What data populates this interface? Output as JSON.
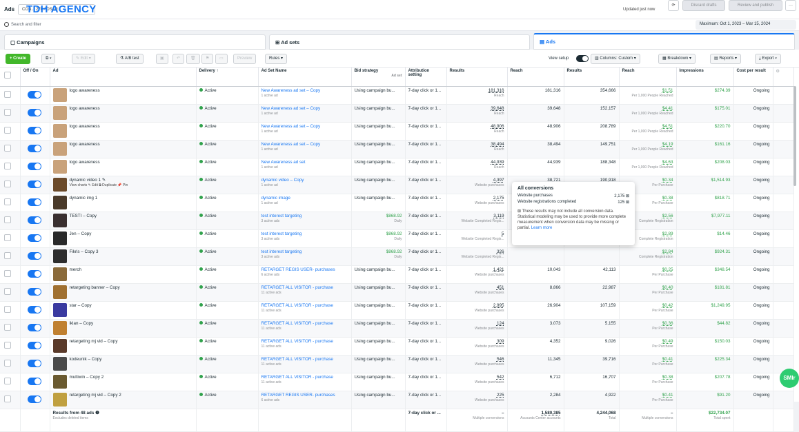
{
  "topbar": {
    "section": "Ads",
    "account": "CON... 270 ADSAP...",
    "watermark": "TDH AGENCY",
    "updated": "Updated just now",
    "discard": "Discard drafts",
    "review": "Review and publish",
    "more": "···"
  },
  "search": {
    "placeholder": "Search and filter",
    "date_range": "Maximum: Oct 1, 2023 – Mar 15, 2024"
  },
  "tabs": {
    "campaigns": "Campaigns",
    "adsets": "Ad sets",
    "ads": "Ads"
  },
  "toolbar": {
    "create": "+ Create",
    "edit": "Edit",
    "ab_test": "A/B test",
    "preview": "Preview",
    "rules": "Rules",
    "view_setup": "View setup",
    "columns": "Columns: Custom",
    "breakdown": "Breakdown",
    "reports": "Reports",
    "export": "Export"
  },
  "columns": [
    "Off / On",
    "Ad",
    "Delivery ↑",
    "Ad Set Name",
    "Bid strategy",
    "Attribution setting",
    "Results",
    "Reach",
    "Results",
    "Reach",
    "Impressions",
    "Cost per result"
  ],
  "bid_sub": "Ad set",
  "rows": [
    {
      "ad": "logo awareness",
      "delivery": "Active",
      "adset": "New Awareness ad set – Copy",
      "adset_sub": "1 active ad",
      "bid": "Using campaign bu...",
      "bid_sub": "",
      "attr": "7-day click or 1...",
      "results": "181,316",
      "results_sub": "Reach",
      "reach": "181,316",
      "impr": "354,666",
      "cpr": "$1.51",
      "cpr_sub": "Per 1,000 People Reached",
      "spent": "$274.39",
      "ending": "Ongoing"
    },
    {
      "ad": "logo awareness",
      "delivery": "Active",
      "adset": "New Awareness ad set – Copy",
      "adset_sub": "1 active ad",
      "bid": "Using campaign bu...",
      "bid_sub": "",
      "attr": "7-day click or 1...",
      "results": "39,648",
      "results_sub": "Reach",
      "reach": "39,648",
      "impr": "152,157",
      "cpr": "$4.41",
      "cpr_sub": "Per 1,000 People Reached",
      "spent": "$175.01",
      "ending": "Ongoing"
    },
    {
      "ad": "logo awareness",
      "delivery": "Active",
      "adset": "New Awareness ad set – Copy",
      "adset_sub": "1 active ad",
      "bid": "Using campaign bu...",
      "bid_sub": "",
      "attr": "7-day click or 1...",
      "results": "48,906",
      "results_sub": "Reach",
      "reach": "48,906",
      "impr": "208,789",
      "cpr": "$4.51",
      "cpr_sub": "Per 1,000 People Reached",
      "spent": "$220.70",
      "ending": "Ongoing"
    },
    {
      "ad": "logo awareness",
      "delivery": "Active",
      "adset": "New Awareness ad set – Copy",
      "adset_sub": "1 active ad",
      "bid": "Using campaign bu...",
      "bid_sub": "",
      "attr": "7-day click or 1...",
      "results": "38,494",
      "results_sub": "Reach",
      "reach": "38,494",
      "impr": "149,751",
      "cpr": "$4.19",
      "cpr_sub": "Per 1,000 People Reached",
      "spent": "$161.16",
      "ending": "Ongoing"
    },
    {
      "ad": "logo awareness",
      "delivery": "Active",
      "adset": "New Awareness ad set",
      "adset_sub": "1 active ad",
      "bid": "Using campaign bu...",
      "bid_sub": "",
      "attr": "7-day click or 1...",
      "results": "44,939",
      "results_sub": "Reach",
      "reach": "44,939",
      "impr": "188,348",
      "cpr": "$4.63",
      "cpr_sub": "Per 1,000 People Reached",
      "spent": "$208.03",
      "ending": "Ongoing"
    },
    {
      "ad": "dynamic video 1 ✎",
      "ad_actions": "View charts  ✎ Edit  ⧉ Duplicate  📌 Pin",
      "delivery": "Active",
      "adset": "dynamic video – Copy",
      "adset_sub": "1 active ad",
      "bid": "Using campaign bu...",
      "bid_sub": "",
      "attr": "7-day click or 1...",
      "results": "4,397",
      "results_sub": "Website purchases",
      "reach": "38,721",
      "impr": "190,918",
      "cpr": "$0.34",
      "cpr_sub": "Per Purchase",
      "spent": "$1,514.93",
      "ending": "Ongoing"
    },
    {
      "ad": "dynamic img 1",
      "delivery": "Active",
      "adset": "dynamic image",
      "adset_sub": "1 active ad",
      "bid": "Using campaign bu...",
      "bid_sub": "",
      "attr": "7-day click or 1...",
      "results": "2,175",
      "results_sub": "Website purchases",
      "reach": "",
      "impr": "",
      "cpr": "$0.38",
      "cpr_sub": "Per Purchase",
      "spent": "$818.71",
      "ending": "Ongoing"
    },
    {
      "ad": "TESTI – Copy",
      "delivery": "Active",
      "adset": "test interest targeting",
      "adset_sub": "3 active ads",
      "bid": "$868.92",
      "bid_sub": "Daily",
      "attr": "7-day click or 1...",
      "results": "3,119",
      "results_sub": "Website Completed Regis...",
      "reach": "",
      "impr": "",
      "cpr": "$2.56",
      "cpr_sub": "Complete Registration",
      "spent": "$7,977.11",
      "ending": "Ongoing"
    },
    {
      "ad": "Jen – Copy",
      "delivery": "Active",
      "adset": "test interest targeting",
      "adset_sub": "3 active ads",
      "bid": "$868.92",
      "bid_sub": "Daily",
      "attr": "7-day click or 1...",
      "results": "5",
      "results_sub": "Website Completed Regis...",
      "reach": "",
      "impr": "",
      "cpr": "$2.89",
      "cpr_sub": "Complete Registration",
      "spent": "$14.46",
      "ending": "Ongoing"
    },
    {
      "ad": "Fikris – Copy 3",
      "delivery": "Active",
      "adset": "test interest targeting",
      "adset_sub": "3 active ads",
      "bid": "$868.92",
      "bid_sub": "Daily",
      "attr": "7-day click or 1...",
      "results": "326",
      "results_sub": "Website Completed Regis...",
      "reach": "",
      "impr": "",
      "cpr": "$2.84",
      "cpr_sub": "Complete Registration",
      "spent": "$924.31",
      "ending": "Ongoing"
    },
    {
      "ad": "merch",
      "delivery": "Active",
      "adset": "RETARGET REGIS USER- purchases",
      "adset_sub": "6 active ads",
      "bid": "Using campaign bu...",
      "bid_sub": "",
      "attr": "7-day click or 1...",
      "results": "1,421",
      "results_sub": "Website purchases",
      "reach": "10,043",
      "impr": "42,113",
      "cpr": "$0.25",
      "cpr_sub": "Per Purchase",
      "spent": "$348.54",
      "ending": "Ongoing"
    },
    {
      "ad": "retargeting banner – Copy",
      "delivery": "Active",
      "adset": "RETARGET ALL VISITOR - purchase",
      "adset_sub": "11 active ads",
      "bid": "Using campaign bu...",
      "bid_sub": "",
      "attr": "7-day click or 1...",
      "results": "451",
      "results_sub": "Website purchases",
      "reach": "8,866",
      "impr": "22,987",
      "cpr": "$0.40",
      "cpr_sub": "Per Purchase",
      "spent": "$181.81",
      "ending": "Ongoing"
    },
    {
      "ad": "star – Copy",
      "delivery": "Active",
      "adset": "RETARGET ALL VISITOR - purchase",
      "adset_sub": "11 active ads",
      "bid": "Using campaign bu...",
      "bid_sub": "",
      "attr": "7-day click or 1...",
      "results": "2,995",
      "results_sub": "Website purchases",
      "reach": "26,904",
      "impr": "107,159",
      "cpr": "$0.42",
      "cpr_sub": "Per Purchase",
      "spent": "$1,249.95",
      "ending": "Ongoing"
    },
    {
      "ad": "iklan – Copy",
      "delivery": "Active",
      "adset": "RETARGET ALL VISITOR - purchase",
      "adset_sub": "11 active ads",
      "bid": "Using campaign bu...",
      "bid_sub": "",
      "attr": "7-day click or 1...",
      "results": "124",
      "results_sub": "Website purchases",
      "reach": "3,073",
      "impr": "5,155",
      "cpr": "$0.36",
      "cpr_sub": "Per Purchase",
      "spent": "$44.82",
      "ending": "Ongoing"
    },
    {
      "ad": "retargeting mj vid – Copy",
      "delivery": "Active",
      "adset": "RETARGET ALL VISITOR - purchase",
      "adset_sub": "11 active ads",
      "bid": "Using campaign bu...",
      "bid_sub": "",
      "attr": "7-day click or 1...",
      "results": "309",
      "results_sub": "Website purchases",
      "reach": "4,352",
      "impr": "9,026",
      "cpr": "$0.49",
      "cpr_sub": "Per Purchase",
      "spent": "$150.03",
      "ending": "Ongoing"
    },
    {
      "ad": "kodeunik – Copy",
      "delivery": "Active",
      "adset": "RETARGET ALL VISITOR - purchase",
      "adset_sub": "11 active ads",
      "bid": "Using campaign bu...",
      "bid_sub": "",
      "attr": "7-day click or 1...",
      "results": "546",
      "results_sub": "Website purchases",
      "reach": "11,345",
      "impr": "39,716",
      "cpr": "$0.41",
      "cpr_sub": "Per Purchase",
      "spent": "$225.34",
      "ending": "Ongoing"
    },
    {
      "ad": "multiwin – Copy 2",
      "delivery": "Active",
      "adset": "RETARGET ALL VISITOR - purchase",
      "adset_sub": "11 active ads",
      "bid": "Using campaign bu...",
      "bid_sub": "",
      "attr": "7-day click or 1...",
      "results": "542",
      "results_sub": "Website purchases",
      "reach": "6,712",
      "impr": "16,707",
      "cpr": "$0.38",
      "cpr_sub": "Per Purchase",
      "spent": "$207.78",
      "ending": "Ongoing"
    },
    {
      "ad": "retargeting mj vid – Copy 2",
      "delivery": "Active",
      "adset": "RETARGET REGIS USER- purchases",
      "adset_sub": "6 active ads",
      "bid": "Using campaign bu...",
      "bid_sub": "",
      "attr": "7-day click or 1...",
      "results": "225",
      "results_sub": "Website purchases",
      "reach": "2,284",
      "impr": "4,922",
      "cpr": "$0.41",
      "cpr_sub": "Per Purchase",
      "spent": "$91.20",
      "ending": "Ongoing"
    }
  ],
  "summary": {
    "label": "Results from 48 ads ❶",
    "sub": "Excludes deleted items",
    "attr": "7-day click or ...",
    "results": "–",
    "results_sub": "Multiple conversions",
    "reach": "1,580,385",
    "reach_sub": "Accounts Center accounts",
    "impr": "4,244,068",
    "impr_sub": "Total",
    "cpr": "–",
    "cpr_sub": "Multiple conversions",
    "spent": "$22,734.07",
    "spent_sub": "Total spent"
  },
  "popup": {
    "title": "All conversions",
    "rows": [
      {
        "label": "Website purchases",
        "value": "2,175 ⊠"
      },
      {
        "label": "Website registrations completed",
        "value": "125 ⊠"
      }
    ],
    "note": "⊠  These results may not include all conversion data. Statistical modeling may be used to provide more complete measurement when conversion data may be missing or partial.",
    "link": "Learn more"
  },
  "chat": "SMIr",
  "thumb_colors": [
    "#c9a27a",
    "#c9a27a",
    "#c9a27a",
    "#c9a27a",
    "#c9a27a",
    "#6b4a2a",
    "#4a3a2a",
    "#3a3030",
    "#2a2a2a",
    "#2e2e2e",
    "#8a6a3a",
    "#a07030",
    "#3a3aa0",
    "#c08030",
    "#5a3a2a",
    "#4a4a4a",
    "#6a5a30",
    "#c0a040"
  ]
}
